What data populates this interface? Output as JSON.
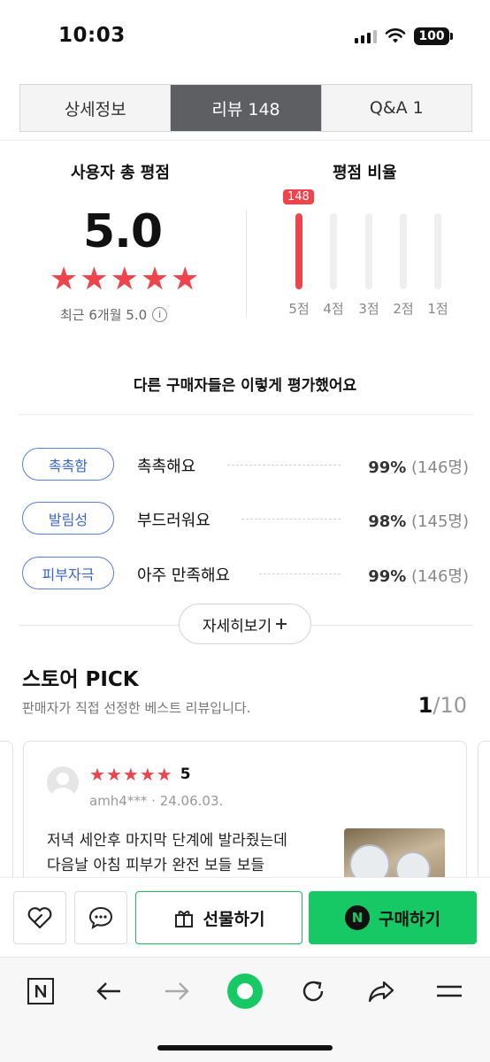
{
  "status_bar": {
    "time": "10:03",
    "battery": "100"
  },
  "tabs": [
    {
      "label": "상세정보",
      "active": false
    },
    {
      "label": "리뷰 148",
      "active": true
    },
    {
      "label": "Q&A 1",
      "active": false
    }
  ],
  "summary": {
    "user_rating_title": "사용자 총 평점",
    "score": "5.0",
    "stars": "★★★★★",
    "recent_label": "최근 6개월 5.0",
    "ratio_title": "평점 비율",
    "bars": [
      {
        "label": "5점",
        "count": "148",
        "fraction": 1.0
      },
      {
        "label": "4점",
        "fraction": 0
      },
      {
        "label": "3점",
        "fraction": 0
      },
      {
        "label": "2점",
        "fraction": 0
      },
      {
        "label": "1점",
        "fraction": 0
      }
    ]
  },
  "evaluation_title": "다른 구매자들은 이렇게 평가했어요",
  "keywords": [
    {
      "tag": "촉촉함",
      "text": "촉촉해요",
      "pct": "99%",
      "count": "(146명)"
    },
    {
      "tag": "발림성",
      "text": "부드러워요",
      "pct": "98%",
      "count": "(145명)"
    },
    {
      "tag": "피부자극",
      "text": "아주 만족해요",
      "pct": "99%",
      "count": "(146명)"
    }
  ],
  "more_button": "자세히보기",
  "store_pick": {
    "title": "스토어 PICK",
    "subtitle": "판매자가 직접 선정한 베스트 리뷰입니다.",
    "page_current": "1",
    "page_total": "/10",
    "review": {
      "stars": "★★★★★",
      "score": "5",
      "user": "amh4***",
      "date": "24.06.03.",
      "line1": "저녁 세안후 마지막 단계에 발라줬는데",
      "line2": "다음날 아침 피부가 완전 보들 보들"
    }
  },
  "actions": {
    "gift_label": "선물하기",
    "buy_label": "구매하기",
    "buy_badge": "N"
  },
  "colors": {
    "accent_red": "#f0444c",
    "naver_green": "#17c964",
    "tag_blue": "#3d66c7"
  }
}
